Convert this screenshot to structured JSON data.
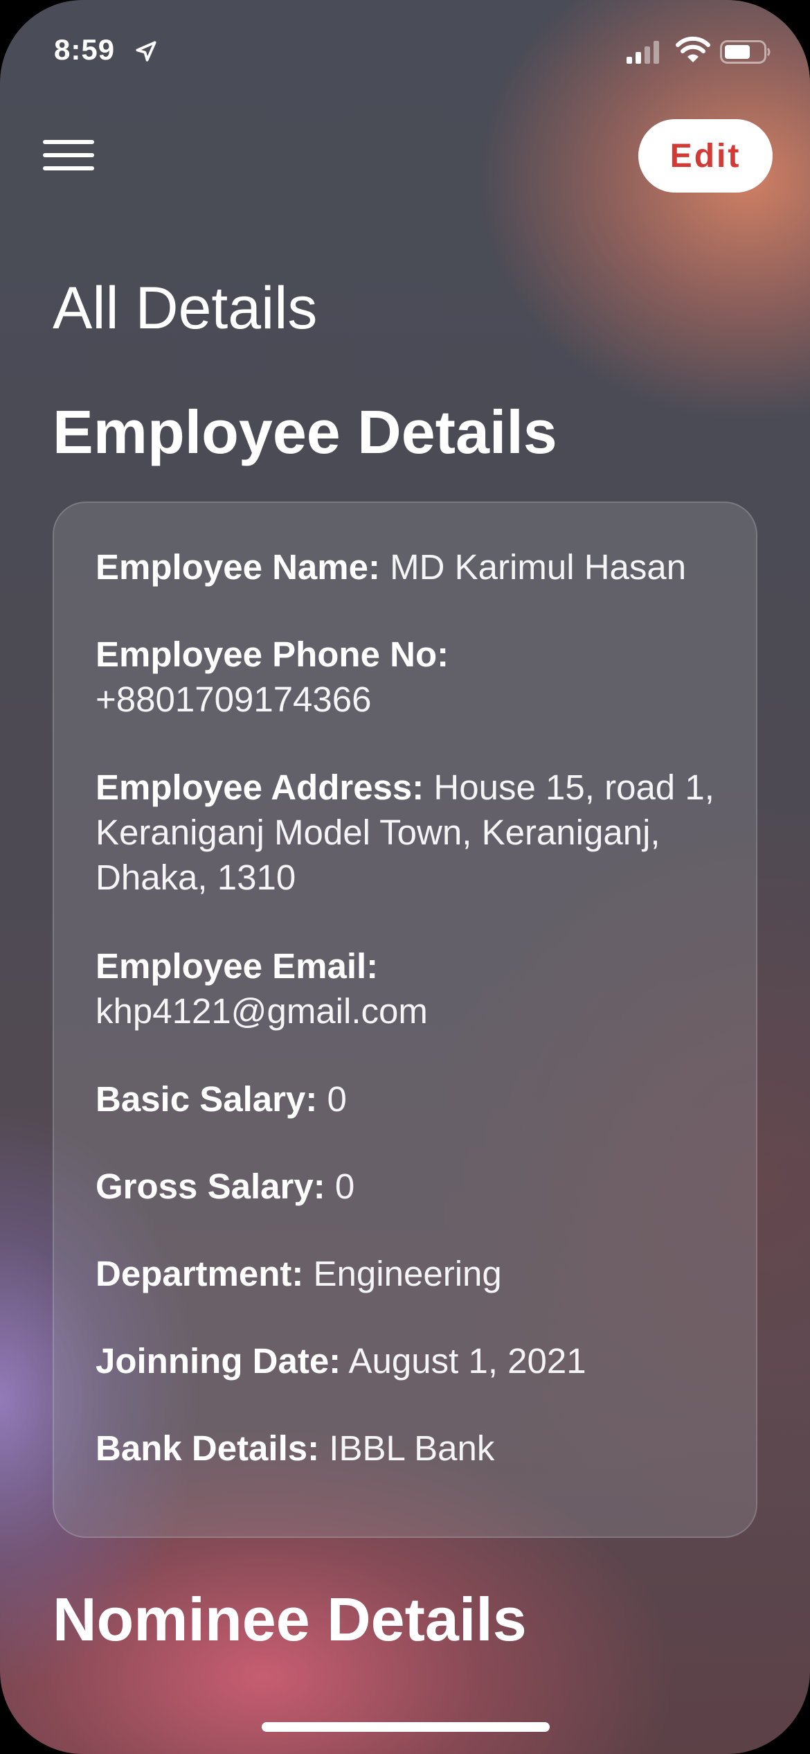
{
  "status_bar": {
    "time": "8:59",
    "icons": [
      "location-arrow-icon",
      "cellular-signal-icon",
      "wifi-icon",
      "battery-icon"
    ]
  },
  "header": {
    "menu_icon": "hamburger-menu-icon",
    "edit_label": "Edit"
  },
  "page_title": "All Details",
  "employee_section": {
    "heading": "Employee Details",
    "fields": [
      {
        "label": "Employee Name:",
        "value": " MD Karimul Hasan"
      },
      {
        "label": "Employee Phone No:",
        "value": "+8801709174366"
      },
      {
        "label": "Employee Address:",
        "value": " House 15, road 1, Keraniganj Model Town, Keraniganj, Dhaka, 1310"
      },
      {
        "label": "Employee Email:",
        "value": "khp4121@gmail.com"
      },
      {
        "label": "Basic Salary:",
        "value": " 0"
      },
      {
        "label": "Gross Salary:",
        "value": " 0"
      },
      {
        "label": "Department:",
        "value": " Engineering"
      },
      {
        "label": "Joinning Date:",
        "value": " August 1, 2021"
      },
      {
        "label": "Bank Details:",
        "value": " IBBL Bank"
      }
    ]
  },
  "nominee_section": {
    "heading": "Nominee Details"
  },
  "colors": {
    "accent": "#d23a36",
    "text": "#ffffff"
  }
}
